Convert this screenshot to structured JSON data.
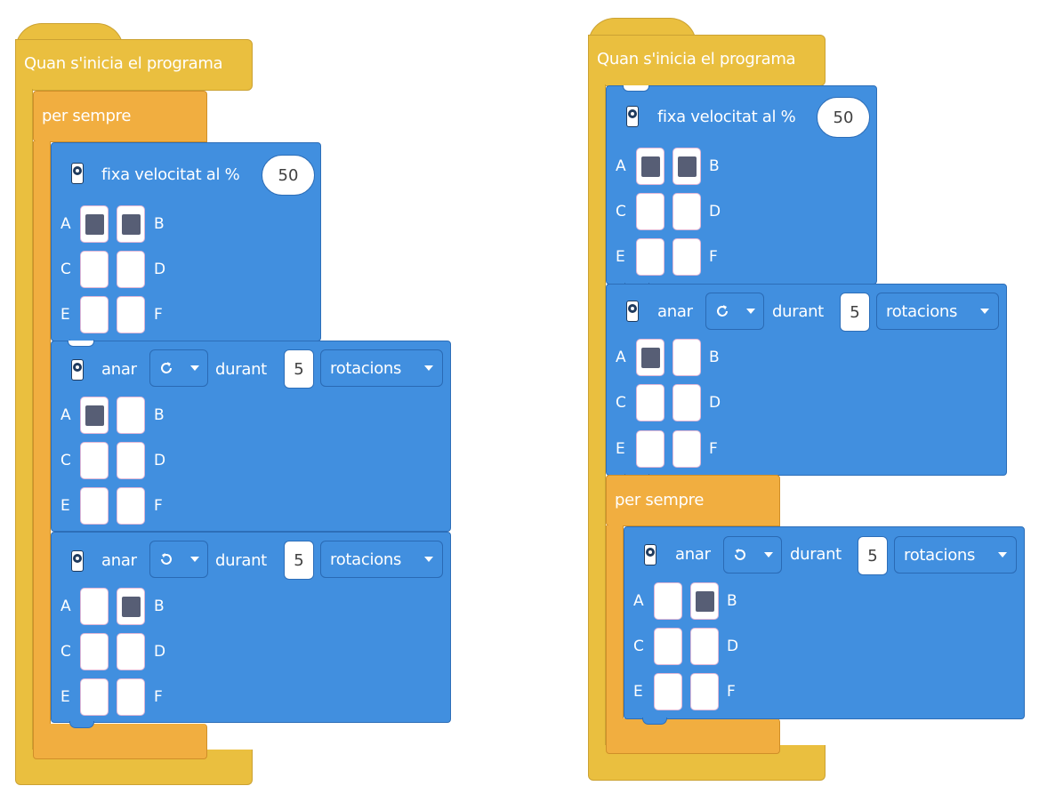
{
  "program_left": {
    "event": {
      "label": "Quan s'inicia el programa"
    },
    "forever": {
      "label": "per sempre"
    },
    "speed_block": {
      "label": "fixa velocitat al %",
      "value": "50",
      "ports": [
        {
          "left": "A",
          "right": "B",
          "left_checked": true,
          "right_checked": true
        },
        {
          "left": "C",
          "right": "D",
          "left_checked": false,
          "right_checked": false
        },
        {
          "left": "E",
          "right": "F",
          "left_checked": false,
          "right_checked": false
        }
      ]
    },
    "run_block_1": {
      "label": "anar",
      "direction_icon": "rotate-clockwise-icon",
      "for_label": "durant",
      "amount": "5",
      "unit": "rotacions",
      "ports": [
        {
          "left": "A",
          "right": "B",
          "left_checked": true,
          "right_checked": false
        },
        {
          "left": "C",
          "right": "D",
          "left_checked": false,
          "right_checked": false
        },
        {
          "left": "E",
          "right": "F",
          "left_checked": false,
          "right_checked": false
        }
      ]
    },
    "run_block_2": {
      "label": "anar",
      "direction_icon": "rotate-counterclockwise-icon",
      "for_label": "durant",
      "amount": "5",
      "unit": "rotacions",
      "ports": [
        {
          "left": "A",
          "right": "B",
          "left_checked": false,
          "right_checked": true
        },
        {
          "left": "C",
          "right": "D",
          "left_checked": false,
          "right_checked": false
        },
        {
          "left": "E",
          "right": "F",
          "left_checked": false,
          "right_checked": false
        }
      ]
    }
  },
  "program_right": {
    "event": {
      "label": "Quan s'inicia el programa"
    },
    "speed_block": {
      "label": "fixa velocitat al %",
      "value": "50",
      "ports": [
        {
          "left": "A",
          "right": "B",
          "left_checked": true,
          "right_checked": true
        },
        {
          "left": "C",
          "right": "D",
          "left_checked": false,
          "right_checked": false
        },
        {
          "left": "E",
          "right": "F",
          "left_checked": false,
          "right_checked": false
        }
      ]
    },
    "run_block_1": {
      "label": "anar",
      "direction_icon": "rotate-clockwise-icon",
      "for_label": "durant",
      "amount": "5",
      "unit": "rotacions",
      "ports": [
        {
          "left": "A",
          "right": "B",
          "left_checked": true,
          "right_checked": false
        },
        {
          "left": "C",
          "right": "D",
          "left_checked": false,
          "right_checked": false
        },
        {
          "left": "E",
          "right": "F",
          "left_checked": false,
          "right_checked": false
        }
      ]
    },
    "forever": {
      "label": "per sempre"
    },
    "run_block_2": {
      "label": "anar",
      "direction_icon": "rotate-counterclockwise-icon",
      "for_label": "durant",
      "amount": "5",
      "unit": "rotacions",
      "ports": [
        {
          "left": "A",
          "right": "B",
          "left_checked": false,
          "right_checked": true
        },
        {
          "left": "C",
          "right": "D",
          "left_checked": false,
          "right_checked": false
        },
        {
          "left": "E",
          "right": "F",
          "left_checked": false,
          "right_checked": false
        }
      ]
    }
  },
  "colors": {
    "event": "#eabf3f",
    "control": "#f1ae40",
    "motion": "#418fdf",
    "checked": "#575e75"
  }
}
